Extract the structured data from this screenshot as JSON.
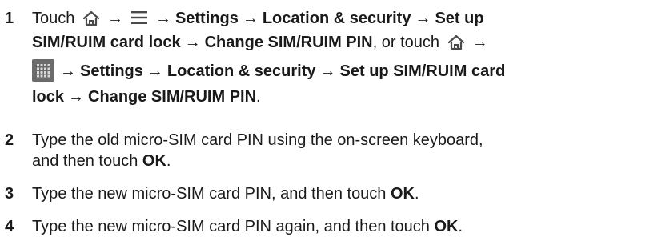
{
  "steps": [
    {
      "number": "1",
      "segments": {
        "touch": "Touch",
        "settings": "Settings",
        "location_security": "Location & security",
        "set_up_lock": "Set up SIM/RUIM card lock",
        "set_up_lock_a": "Set up",
        "set_up_lock_b": "SIM/RUIM card lock",
        "set_up_lock_c": "Set up SIM/RUIM card",
        "set_up_lock_d": "lock",
        "change_pin": "Change SIM/RUIM PIN",
        "or_touch": ", or touch",
        "period": "."
      },
      "icons": [
        "home-icon",
        "menu-icon",
        "home-icon",
        "apps-icon"
      ]
    },
    {
      "number": "2",
      "text_a": "Type the old micro-SIM card PIN using the on-screen keyboard,",
      "text_b": "and then touch",
      "bold": "OK",
      "period": "."
    },
    {
      "number": "3",
      "text_a": "Type the new micro-SIM card PIN, and then touch",
      "bold": "OK",
      "period": "."
    },
    {
      "number": "4",
      "text_a": "Type the new micro-SIM card PIN again, and then touch",
      "bold": "OK",
      "period": "."
    }
  ],
  "arrow_glyph": "→",
  "colors": {
    "text": "#1a1a1a",
    "icon": "#4a4a4a",
    "apps_icon_bg": "#6b6b6b"
  }
}
